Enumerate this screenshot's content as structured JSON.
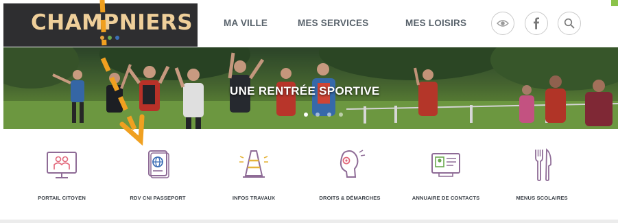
{
  "site": {
    "logo": "CHAMPNIERS",
    "logo_dot_colors": [
      "#e8a23a",
      "#6aa84f",
      "#3d6fb6"
    ]
  },
  "nav": {
    "items": [
      {
        "label": "MA VILLE"
      },
      {
        "label": "MES SERVICES"
      },
      {
        "label": "MES LOISIRS"
      }
    ],
    "icon_buttons": [
      {
        "icon": "eye-icon"
      },
      {
        "icon": "facebook-icon"
      },
      {
        "icon": "search-icon"
      }
    ]
  },
  "banner": {
    "title": "UNE RENTRÉE SPORTIVE",
    "slides": 4,
    "active_slide": 1
  },
  "quick_links": [
    {
      "label": "PORTAIL CITOYEN",
      "icon": "citizen-portal-icon"
    },
    {
      "label": "RDV CNI PASSEPORT",
      "icon": "passport-icon"
    },
    {
      "label": "INFOS TRAVAUX",
      "icon": "traffic-cone-icon"
    },
    {
      "label": "DROITS & DÉMARCHES",
      "icon": "rights-procedures-icon"
    },
    {
      "label": "ANNUAIRE DE CONTACTS",
      "icon": "contact-card-icon"
    },
    {
      "label": "MENUS SCOLAIRES",
      "icon": "fork-knife-icon"
    }
  ],
  "colors": {
    "logo_bg": "#2e2e30",
    "logo_text": "#efcf9a",
    "nav_text": "#58626b",
    "icon_accent": "#8e6b96",
    "annotation": "#f0a020",
    "corner_tab": "#8bc34a"
  }
}
